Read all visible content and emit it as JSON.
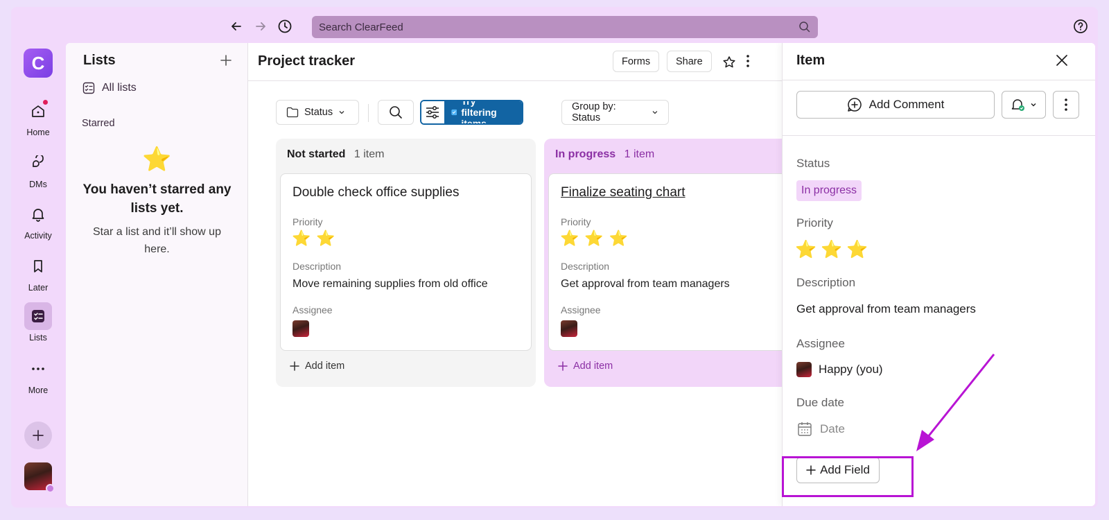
{
  "topbar": {
    "search_placeholder": "Search ClearFeed"
  },
  "rail": {
    "logo_letter": "C",
    "items": [
      {
        "label": "Home"
      },
      {
        "label": "DMs"
      },
      {
        "label": "Activity"
      },
      {
        "label": "Later"
      },
      {
        "label": "Lists"
      },
      {
        "label": "More"
      }
    ]
  },
  "lists_sidebar": {
    "title": "Lists",
    "all_lists": "All lists",
    "starred": "Starred",
    "empty_title": "You haven’t starred any lists yet.",
    "empty_subtitle": "Star a list and it’ll show up here."
  },
  "board": {
    "title": "Project tracker",
    "forms_label": "Forms",
    "share_label": "Share",
    "filters": {
      "status_label": "Status",
      "try_filtering": "Try filtering items",
      "group_by": "Group by: Status"
    },
    "columns": [
      {
        "name": "Not started",
        "count": "1 item",
        "card": {
          "title": "Double check office supplies",
          "priority_label": "Priority",
          "priority_stars": 2,
          "description_label": "Description",
          "description": "Move remaining supplies from old office",
          "assignee_label": "Assignee"
        },
        "add_item": "Add item"
      },
      {
        "name": "In progress",
        "count": "1 item",
        "card": {
          "title": "Finalize seating chart",
          "priority_label": "Priority",
          "priority_stars": 3,
          "description_label": "Description",
          "description": "Get approval from team managers",
          "assignee_label": "Assignee"
        },
        "add_item": "Add item"
      }
    ]
  },
  "item_pane": {
    "title": "Item",
    "add_comment": "Add Comment",
    "status_label": "Status",
    "status_value": "In progress",
    "priority_label": "Priority",
    "priority_stars": 3,
    "description_label": "Description",
    "description": "Get approval from team managers",
    "assignee_label": "Assignee",
    "assignee": "Happy (you)",
    "due_date_label": "Due date",
    "due_date_placeholder": "Date",
    "add_field": "Add Field"
  },
  "colors": {
    "accent_purple": "#8b2fa4",
    "highlight_magenta": "#b814d4",
    "filter_blue": "#1264a3",
    "star_yellow": "#f5c518"
  }
}
